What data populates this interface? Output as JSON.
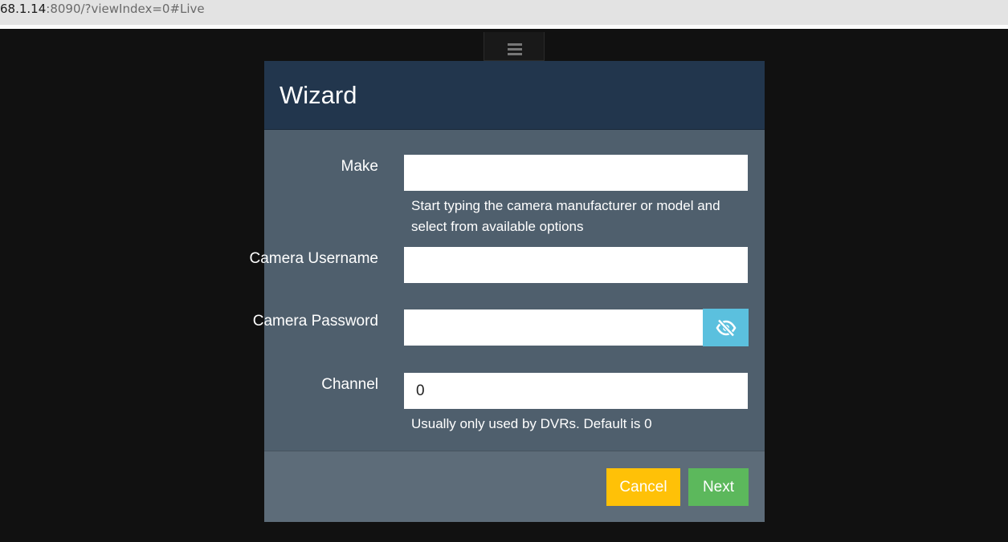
{
  "browser": {
    "url_host": "68.1.14",
    "url_rest": ":8090/?viewIndex=0#Live"
  },
  "header": {
    "menu_icon": "hamburger-menu-icon"
  },
  "wizard": {
    "title": "Wizard",
    "fields": {
      "make": {
        "label": "Make",
        "value": "",
        "help": "Start typing the camera manufacturer or model and select from available options"
      },
      "username": {
        "label": "Camera Username",
        "value": ""
      },
      "password": {
        "label": "Camera Password",
        "value": "",
        "toggle_icon": "eye-slash-icon"
      },
      "channel": {
        "label": "Channel",
        "value": "0",
        "help": "Usually only used by DVRs. Default is 0"
      }
    },
    "buttons": {
      "cancel": "Cancel",
      "next": "Next"
    },
    "colors": {
      "header": "#22364d",
      "body": "#4f5f6d",
      "footer": "#5d6c79",
      "cancel": "#ffc107",
      "next": "#5cb85c",
      "toggle": "#5bc0de"
    }
  }
}
